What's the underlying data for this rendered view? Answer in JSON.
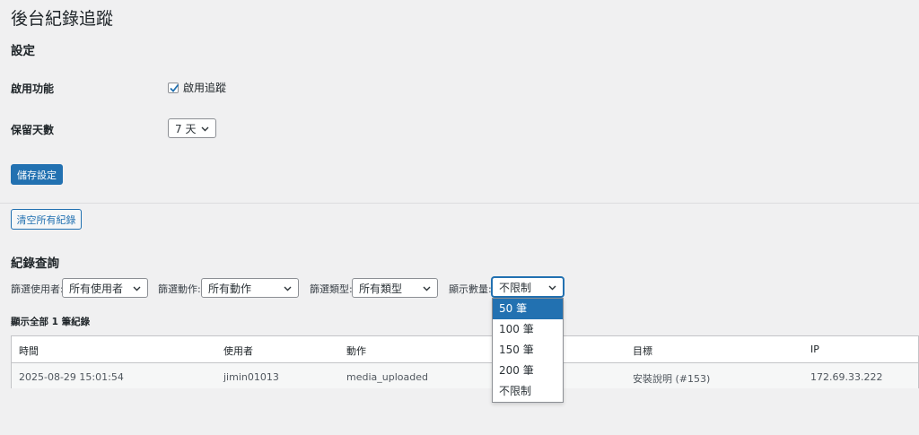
{
  "page": {
    "title": "後台紀錄追蹤"
  },
  "settings": {
    "section_title": "設定",
    "enable_label": "啟用功能",
    "enable_checkbox_label": "啟用追蹤",
    "enable_checked": true,
    "retention_label": "保留天數",
    "retention_value": "7 天",
    "save_button": "儲存設定"
  },
  "actions": {
    "clear_button": "清空所有紀錄"
  },
  "query": {
    "section_title": "紀錄查詢",
    "filter_user_label": "篩選使用者:",
    "filter_user_value": "所有使用者",
    "filter_action_label": "篩選動作:",
    "filter_action_value": "所有動作",
    "filter_type_label": "篩選類型:",
    "filter_type_value": "所有類型",
    "limit_label": "顯示數量:",
    "limit_value": "不限制",
    "limit_options": [
      "50 筆",
      "100 筆",
      "150 筆",
      "200 筆",
      "不限制"
    ],
    "limit_highlighted": "50 筆",
    "count_text": "顯示全部 1 筆紀錄"
  },
  "table": {
    "headers": [
      "時間",
      "使用者",
      "動作",
      "目標",
      "IP"
    ],
    "rows": [
      [
        "2025-08-29 15:01:54",
        "jimin01013",
        "media_uploaded",
        "安裝說明 (#153)",
        "172.69.33.222"
      ]
    ]
  },
  "colors": {
    "accent": "#2271b1",
    "background": "#f0f0f1"
  }
}
